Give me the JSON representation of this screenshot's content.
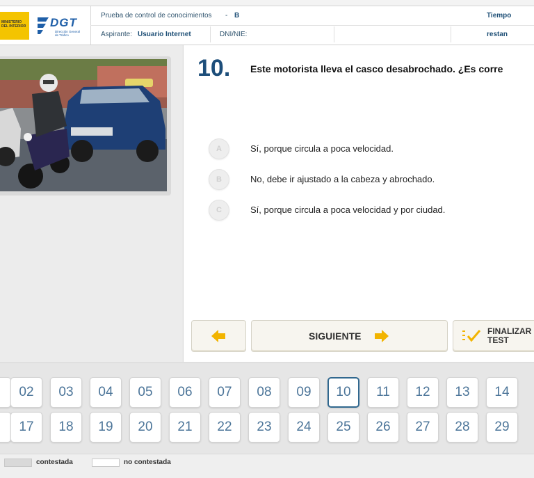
{
  "header": {
    "ministry_label": "MINISTERIO DEL INTERIOR",
    "dgt_label": "DGT",
    "dgt_sub": "Dirección General de Tráfico",
    "exam_title": "Prueba de control de conocimientos",
    "exam_separator": "-",
    "exam_type": "B",
    "time_label": "Tiempo restan",
    "applicant_label": "Aspirante:",
    "applicant_value": "Usuario Internet",
    "dni_label": "DNI/NIE:"
  },
  "question": {
    "number": "10.",
    "text": "Este motorista lleva el casco desabrochado. ¿Es corre",
    "options": [
      {
        "letter": "A",
        "text": "Sí, porque circula a poca velocidad."
      },
      {
        "letter": "B",
        "text": "No, debe ir ajustado a la cabeza y abrochado."
      },
      {
        "letter": "C",
        "text": "Sí, porque circula a poca velocidad y por ciudad."
      }
    ]
  },
  "nav": {
    "next_label": "SIGUIENTE",
    "finish_line1": "FINALIZAR",
    "finish_line2": "TEST"
  },
  "grid": {
    "current": "10",
    "row1": [
      "02",
      "03",
      "04",
      "05",
      "06",
      "07",
      "08",
      "09",
      "10",
      "11",
      "12",
      "13",
      "14"
    ],
    "row2": [
      "17",
      "18",
      "19",
      "20",
      "21",
      "22",
      "23",
      "24",
      "25",
      "26",
      "27",
      "28",
      "29"
    ]
  },
  "legend": {
    "answered": "contestada",
    "unanswered": "no contestada",
    "answered_color": "#d9d9d9",
    "unanswered_color": "#ffffff"
  },
  "colors": {
    "accent": "#1d4e7a",
    "arrow": "#f2b400",
    "brand_yellow": "#f4c400",
    "dgt_blue": "#1f5fa8"
  }
}
